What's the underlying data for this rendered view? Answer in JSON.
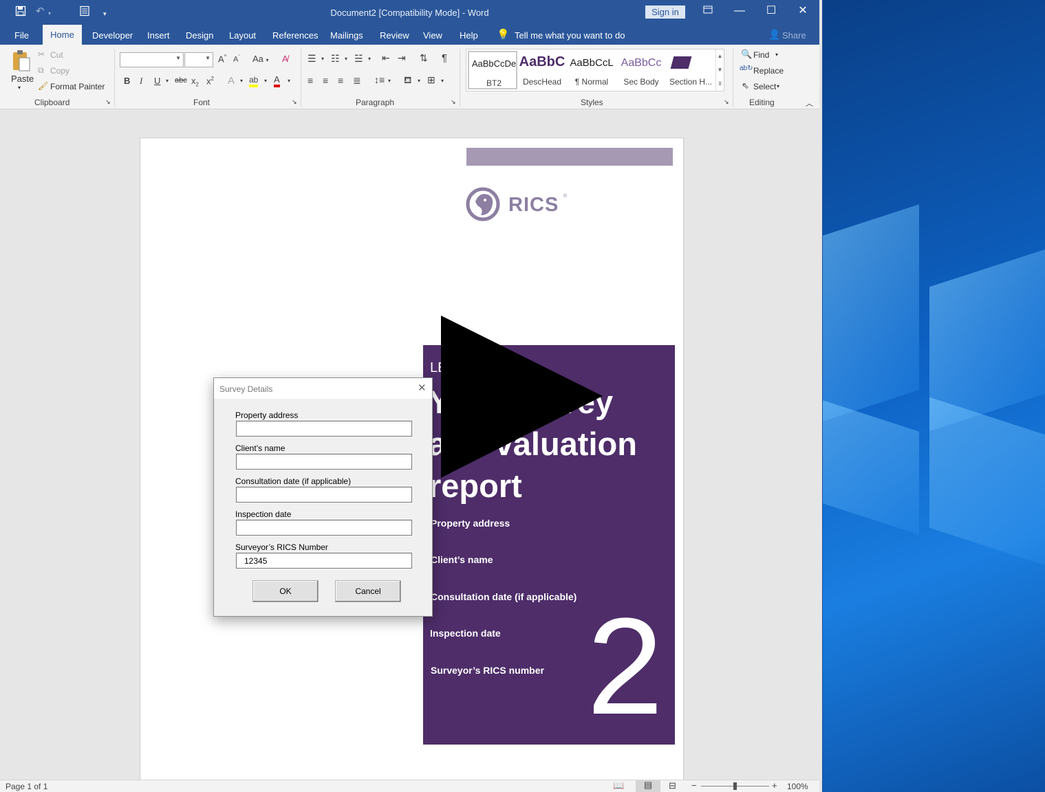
{
  "window": {
    "title": "Document2 [Compatibility Mode]  -  Word",
    "sign_in": "Sign in"
  },
  "tabs": [
    "File",
    "Home",
    "Developer",
    "Insert",
    "Design",
    "Layout",
    "References",
    "Mailings",
    "Review",
    "View",
    "Help"
  ],
  "tell_me": "Tell me what you want to do",
  "share": "Share",
  "ribbon": {
    "clipboard": {
      "paste": "Paste",
      "cut": "Cut",
      "copy": "Copy",
      "format_painter": "Format Painter",
      "label": "Clipboard"
    },
    "font": {
      "label": "Font",
      "change_case": "Aa"
    },
    "paragraph": {
      "label": "Paragraph"
    },
    "styles": {
      "label": "Styles",
      "items": [
        {
          "preview": "AaBbCcDe",
          "name": "BT2"
        },
        {
          "preview": "AaBbC",
          "name": "DescHead"
        },
        {
          "preview": "AaBbCcL",
          "name": "¶ Normal"
        },
        {
          "preview": "AaBbCc",
          "name": "Sec Body"
        },
        {
          "preview": "",
          "name": "Section H..."
        }
      ]
    },
    "editing": {
      "label": "Editing",
      "find": "Find",
      "replace": "Replace",
      "select": "Select"
    }
  },
  "document": {
    "logo_text": "RICS",
    "cover_level": "LEVEL",
    "cover_title_lines": [
      "Your survey",
      "and valuation",
      "report"
    ],
    "cover_fields": [
      "Property address",
      "Client’s name",
      "Consultation date (if applicable)",
      "Inspection date",
      "Surveyor’s RICS number"
    ],
    "cover_number": "2",
    "colors": {
      "accent_bar": "#a699b3",
      "cover_bg": "#4e2d69",
      "logo": "#8d7fa2"
    }
  },
  "dialog": {
    "title": "Survey Details",
    "fields": [
      {
        "label": "Property address",
        "value": ""
      },
      {
        "label": "Client’s name",
        "value": ""
      },
      {
        "label": "Consultation date (if applicable)",
        "value": ""
      },
      {
        "label": "Inspection date",
        "value": ""
      },
      {
        "label": "Surveyor’s RICS Number",
        "value": "12345"
      }
    ],
    "ok": "OK",
    "cancel": "Cancel"
  },
  "status": {
    "page": "Page 1 of 1",
    "zoom": "100%"
  }
}
